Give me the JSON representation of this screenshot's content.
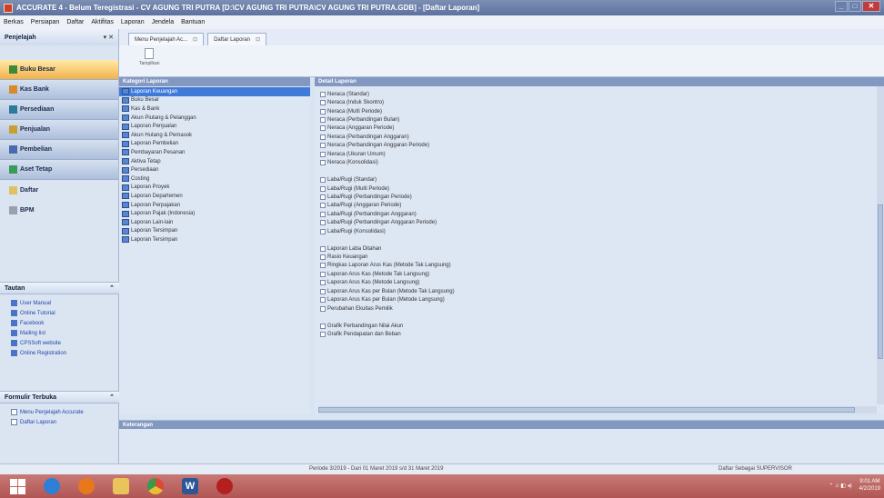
{
  "window": {
    "title": "ACCURATE 4 - Belum Teregistrasi - CV AGUNG TRI PUTRA   [D:\\CV AGUNG TRI PUTRA\\CV AGUNG TRI PUTRA.GDB] - [Daftar Laporan]"
  },
  "menu": [
    "Berkas",
    "Persiapan",
    "Daftar",
    "Aktifitas",
    "Laporan",
    "Jendela",
    "Bantuan"
  ],
  "left": {
    "title": "Penjelajah",
    "controls": "▾ ✕",
    "nav": [
      {
        "label": "Buku Besar",
        "color": "#3a8a3a"
      },
      {
        "label": "Kas Bank",
        "color": "#d98a2a"
      },
      {
        "label": "Persediaan",
        "color": "#2a7a9a"
      },
      {
        "label": "Penjualan",
        "color": "#c8a030"
      },
      {
        "label": "Pembelian",
        "color": "#4a6ab0"
      },
      {
        "label": "Aset Tetap",
        "color": "#3a9a5a"
      },
      {
        "label": "Daftar",
        "color": "#e0c060"
      },
      {
        "label": "BPM",
        "color": "#9aa0b0"
      }
    ],
    "tautan": {
      "title": "Tautan",
      "links": [
        "User Manual",
        "Online Tutorial",
        "Facebook",
        "Mailing list",
        "CPSSoft website",
        "Online Registration"
      ]
    },
    "formulir": {
      "title": "Formulir Terbuka",
      "links": [
        "Menu Penjelajah Accurate",
        "Daftar Laporan"
      ]
    }
  },
  "tabs": [
    "Menu Penjelajah Ac...",
    "Daftar Laporan"
  ],
  "toolbar": {
    "button": "Tampilkan"
  },
  "kategori": {
    "title": "Kategori Laporan",
    "items": [
      "Laporan Keuangan",
      "Buku Besar",
      "Kas & Bank",
      "Akun Piutang & Pelanggan",
      "Laporan Penjualan",
      "Akun Hutang & Pemasok",
      "Laporan Pembelian",
      "Pembayaran Pesanan",
      "Aktiva Tetap",
      "Persediaan",
      "Costing",
      "Laporan Proyek",
      "Laporan Departemen",
      "Laporan Perpajakan",
      "Laporan Pajak (Indonesia)",
      "Laporan Lain-lain",
      "Laporan Tersimpan",
      "Laporan Tersimpan"
    ],
    "selected_index": 0
  },
  "detail": {
    "title": "Detail Laporan",
    "items": [
      "Neraca (Standar)",
      "Neraca (Induk Skontro)",
      "Neraca (Multi Periode)",
      "Neraca (Perbandingan Bulan)",
      "Neraca (Anggaran Periode)",
      "Neraca (Perbandingan Anggaran)",
      "Neraca (Perbandingan Anggaran Periode)",
      "Neraca (Ukuran Umum)",
      "Neraca (Konsolidasi)",
      "",
      "Laba/Rugi (Standar)",
      "Laba/Rugi (Multi Periode)",
      "Laba/Rugi (Perbandingan Periode)",
      "Laba/Rugi (Anggaran Periode)",
      "Laba/Rugi (Perbandingan Anggaran)",
      "Laba/Rugi (Perbandingan Anggaran Periode)",
      "Laba/Rugi (Konsolidasi)",
      "",
      "Laporan Laba Ditahan",
      "Rasio Keuangan",
      "Ringkas Laporan Arus Kas (Metode Tak Langsung)",
      "Laporan Arus Kas (Metode Tak Langsung)",
      "Laporan Arus Kas (Metode Langsung)",
      "Laporan Arus Kas per Bulan (Metode Tak Langsung)",
      "Laporan Arus Kas per Bulan (Metode Langsung)",
      "Perubahan Ekuitas Pemilik",
      "",
      "Grafik Perbandingan Nilai Akun",
      "Grafik Pendapatan dan Beban"
    ]
  },
  "keterangan": {
    "title": "Keterangan"
  },
  "status": {
    "period": "Periode 3/2019 - Dari 01 Maret 2019 s/d 31 Maret 2019",
    "user": "Daftar Sebagai SUPERVISOR"
  },
  "taskbar": {
    "apps": [
      "windows-start",
      "internet-explorer",
      "firefox",
      "file-explorer",
      "chrome",
      "word",
      "accurate"
    ],
    "time": "9:01 AM",
    "date": "4/2/2019"
  }
}
